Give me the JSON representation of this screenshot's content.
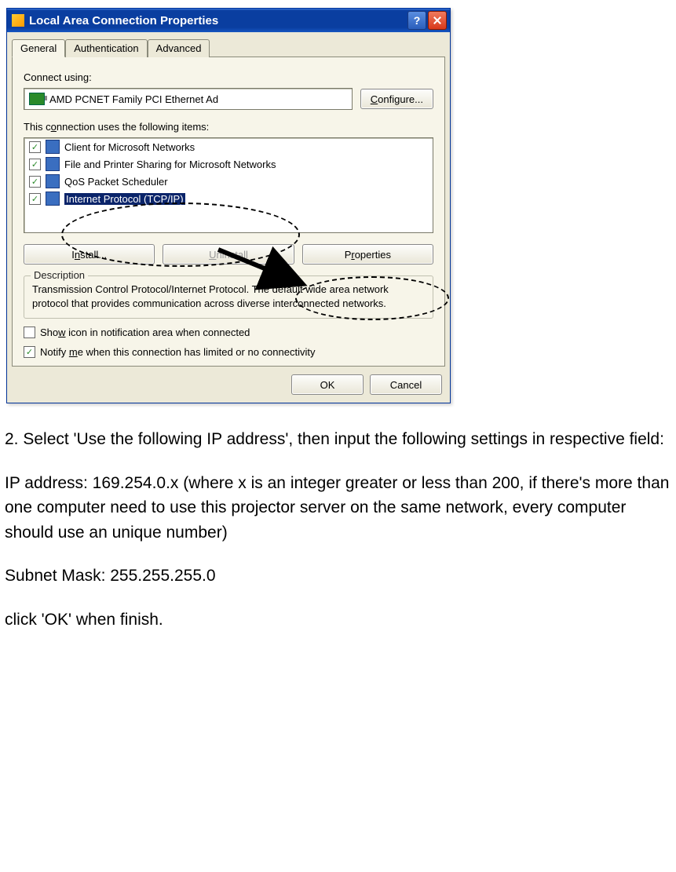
{
  "dialog": {
    "title": "Local Area Connection Properties",
    "tabs": [
      "General",
      "Authentication",
      "Advanced"
    ],
    "active_tab": 0,
    "connect_using_label": "Connect using:",
    "adapter_name": "AMD PCNET Family PCI Ethernet Ad",
    "configure_btn": "Configure...",
    "items_label": "This connection uses the following items:",
    "items": [
      {
        "checked": true,
        "label": "Client for Microsoft Networks",
        "selected": false
      },
      {
        "checked": true,
        "label": "File and Printer Sharing for Microsoft Networks",
        "selected": false
      },
      {
        "checked": true,
        "label": "QoS Packet Scheduler",
        "selected": false
      },
      {
        "checked": true,
        "label": "Internet Protocol (TCP/IP)",
        "selected": true
      }
    ],
    "install_btn": "Install...",
    "uninstall_btn": "Uninstall",
    "properties_btn": "Properties",
    "description_title": "Description",
    "description_text": "Transmission Control Protocol/Internet Protocol. The default wide area network protocol that provides communication across diverse interconnected networks.",
    "show_icon_checked": false,
    "show_icon_label": "Show icon in notification area when connected",
    "notify_checked": true,
    "notify_label": "Notify me when this connection has limited or no connectivity",
    "ok_btn": "OK",
    "cancel_btn": "Cancel"
  },
  "instructions": {
    "step2_intro": "2. Select 'Use the following IP address', then input the following settings in respective field:",
    "ip_line": "IP address: 169.254.0.x (where x is an integer greater or less than 200, if there's more than one computer need to use this projector server on the same network, every computer should use an unique number)",
    "subnet_line": "Subnet Mask: 255.255.255.0",
    "finish_line": "click 'OK' when finish."
  }
}
